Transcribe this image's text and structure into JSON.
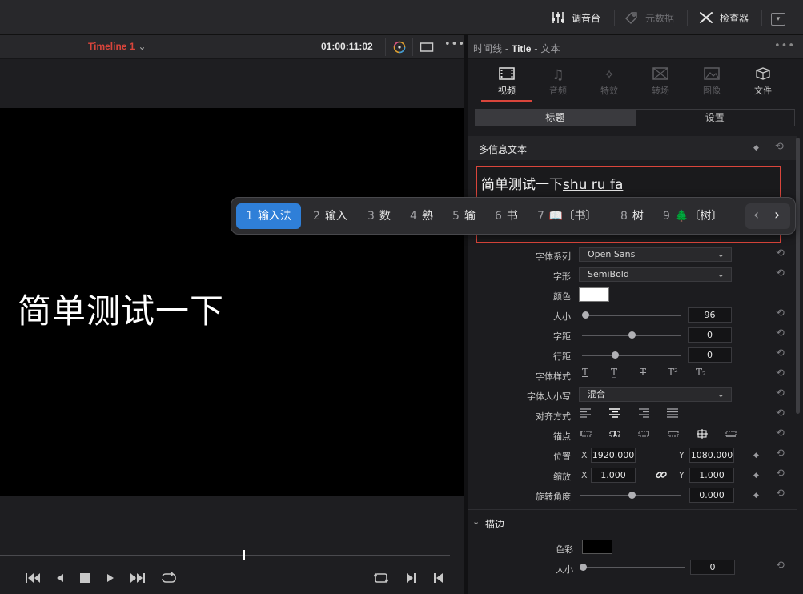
{
  "topbar": {
    "mixer": "调音台",
    "metadata": "元数据",
    "inspector": "检查器"
  },
  "viewer": {
    "timeline_name": "Timeline 1",
    "timecode": "01:00:11:02",
    "video_text": "简单测试一下"
  },
  "inspector": {
    "path_prefix": "时间线 - ",
    "path_title": "Title",
    "path_suffix": " - 文本",
    "tabs": [
      {
        "label": "视频",
        "icon": "film-icon"
      },
      {
        "label": "音频",
        "icon": "music-note-icon"
      },
      {
        "label": "特效",
        "icon": "magic-wand-icon"
      },
      {
        "label": "转场",
        "icon": "transition-icon"
      },
      {
        "label": "图像",
        "icon": "image-icon"
      },
      {
        "label": "文件",
        "icon": "file-cube-icon"
      }
    ],
    "subtabs": [
      "标题",
      "设置"
    ],
    "rich_text_title": "多信息文本",
    "text_committed": "简单测试一下",
    "text_preedit": "shu ru fa",
    "props": {
      "font_family_label": "字体系列",
      "font_family": "Open Sans",
      "font_face_label": "字形",
      "font_face": "SemiBold",
      "color_label": "颜色",
      "size_label": "大小",
      "size": "96",
      "tracking_label": "字距",
      "tracking": "0",
      "line_spacing_label": "行距",
      "line_spacing": "0",
      "font_style_label": "字体样式",
      "case_label": "字体大小写",
      "case": "混合",
      "align_label": "对齐方式",
      "anchor_label": "锚点",
      "position_label": "位置",
      "pos_x": "1920.000",
      "pos_y": "1080.000",
      "zoom_label": "缩放",
      "zoom_x": "1.000",
      "zoom_y": "1.000",
      "rotation_label": "旋转角度",
      "rotation": "0.000",
      "x": "X",
      "y": "Y"
    },
    "stroke": {
      "title": "描边",
      "color_label": "色彩",
      "size_label": "大小",
      "size": "0"
    }
  },
  "ime": {
    "candidates": [
      {
        "n": "1",
        "text": "输入法"
      },
      {
        "n": "2",
        "text": "输入"
      },
      {
        "n": "3",
        "text": "数"
      },
      {
        "n": "4",
        "text": "熟"
      },
      {
        "n": "5",
        "text": "输"
      },
      {
        "n": "6",
        "text": "书"
      },
      {
        "n": "7",
        "text": "📖〔书〕"
      },
      {
        "n": "8",
        "text": "树"
      },
      {
        "n": "9",
        "text": "🌲〔树〕"
      }
    ]
  },
  "colors": {
    "accent_red": "#d9453b",
    "ime_selected": "#2f7fd8",
    "text_color_swatch": "#ffffff",
    "stroke_color_swatch": "#000000"
  }
}
